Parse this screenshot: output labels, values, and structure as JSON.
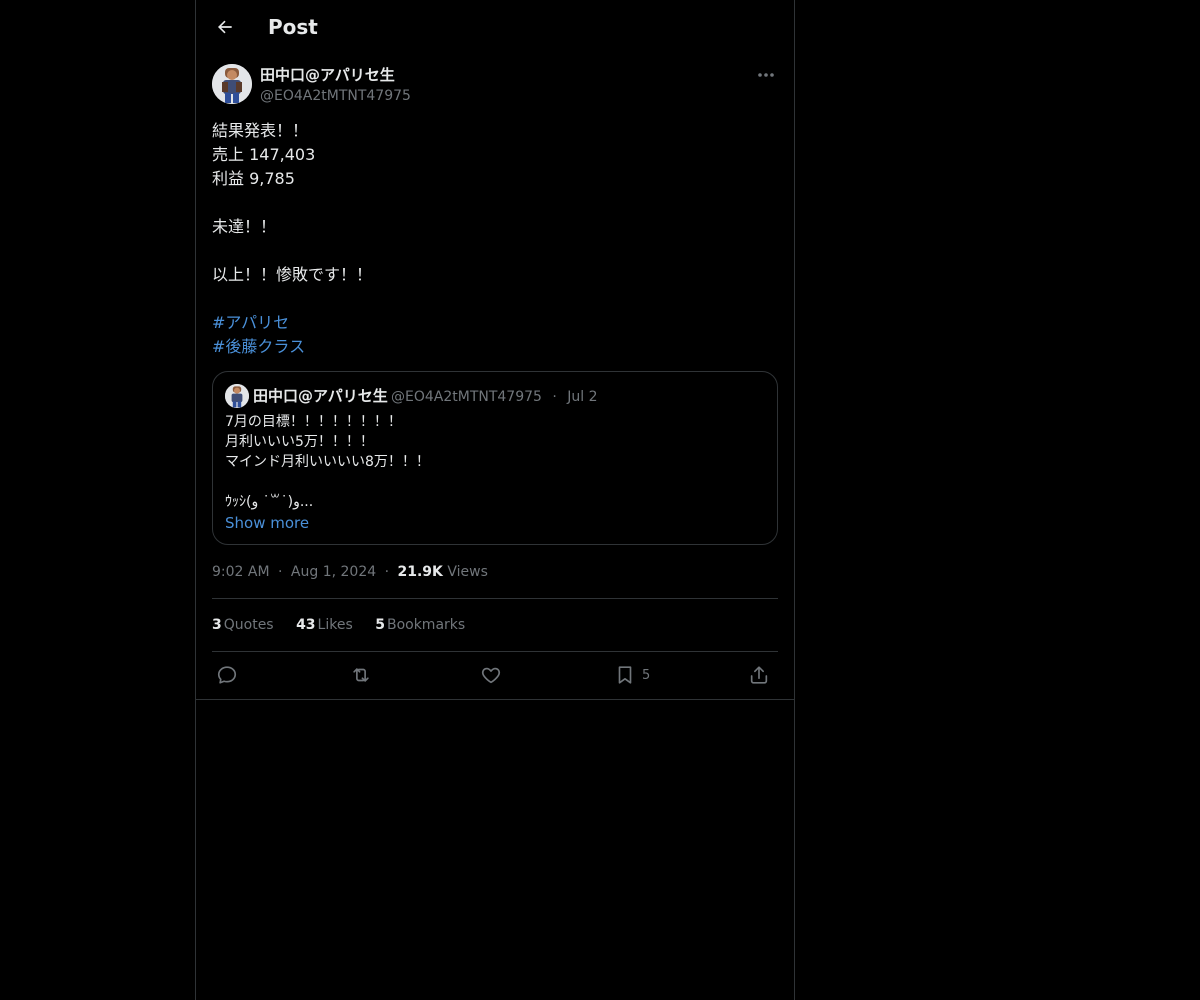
{
  "header": {
    "title": "Post"
  },
  "author": {
    "name": "田中口@アパリセ生",
    "handle": "@EO4A2tMTNT47975"
  },
  "post": {
    "lines": [
      "結果発表！！",
      "売上 147,403",
      "利益 9,785",
      "",
      "未達！！",
      "",
      "以上！！惨敗です！！",
      ""
    ],
    "hashtags": [
      "#アパリセ",
      "#後藤クラス"
    ]
  },
  "quoted": {
    "name": "田中口@アパリセ生",
    "handle": "@EO4A2tMTNT47975",
    "dot": "·",
    "date": "Jul 2",
    "lines": [
      "7月の目標！！！！！！！！",
      "月利いいい5万！！！！",
      "マインド月利いいいい8万！！！",
      "",
      "ｳｯｼ(و ˙꒳˙)و..."
    ],
    "show_more": "Show more"
  },
  "meta": {
    "time": "9:02 AM",
    "dot": "·",
    "date": "Aug 1, 2024",
    "views_count": "21.9K",
    "views_label": "Views"
  },
  "stats": {
    "quotes_count": "3",
    "quotes_label": "Quotes",
    "likes_count": "43",
    "likes_label": "Likes",
    "bookmarks_count": "5",
    "bookmarks_label": "Bookmarks"
  },
  "actions": {
    "bookmark_count": "5"
  },
  "colors": {
    "background": "#000000",
    "text": "#e7e9ea",
    "muted": "#71767b",
    "link": "#4a90d9",
    "border": "#2f3336"
  },
  "icons": [
    "arrow-left-icon",
    "more-horizontal-icon",
    "reply-icon",
    "repost-icon",
    "heart-icon",
    "bookmark-icon",
    "share-icon"
  ]
}
